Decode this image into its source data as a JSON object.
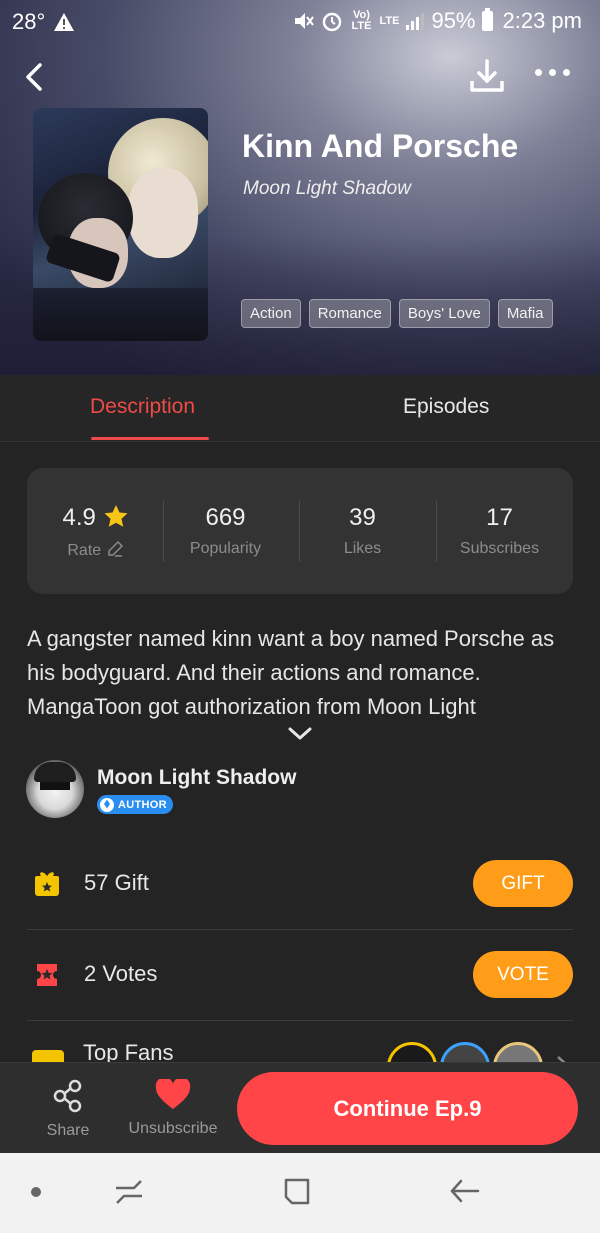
{
  "status_bar": {
    "temperature": "28°",
    "network_label": "Vo) LTE",
    "lte_label": "LTE",
    "battery_percent": "95%",
    "time": "2:23 pm"
  },
  "header": {
    "back_icon": "back-arrow-icon",
    "download_icon": "download-icon",
    "more_icon": "more-dots-icon"
  },
  "comic": {
    "title": "Kinn And Porsche",
    "author": "Moon Light Shadow",
    "tags": [
      "Action",
      "Romance",
      "Boys' Love",
      "Mafia"
    ]
  },
  "tabs": [
    {
      "label": "Description",
      "active": true
    },
    {
      "label": "Episodes",
      "active": false
    }
  ],
  "stats": [
    {
      "value": "4.9",
      "label": "Rate"
    },
    {
      "value": "669",
      "label": "Popularity"
    },
    {
      "value": "39",
      "label": "Likes"
    },
    {
      "value": "17",
      "label": "Subscribes"
    }
  ],
  "description": "A gangster named kinn want a boy named Porsche as his bodyguard. And their actions and romance. MangaToon got authorization from Moon Light",
  "author_card": {
    "name": "Moon Light Shadow",
    "badge": "AUTHOR"
  },
  "gift_row": {
    "text": "57  Gift",
    "button": "GIFT"
  },
  "votes_row": {
    "text": "2  Votes",
    "button": "VOTE"
  },
  "fans_row": {
    "text": "Top Fans"
  },
  "bottom_bar": {
    "share_label": "Share",
    "unsubscribe_label": "Unsubscribe",
    "continue_label": "Continue Ep.9"
  },
  "colors": {
    "accent_red": "#ef4a48",
    "button_orange": "#ff9c18",
    "continue_red": "#ff4548",
    "background": "#242424"
  }
}
